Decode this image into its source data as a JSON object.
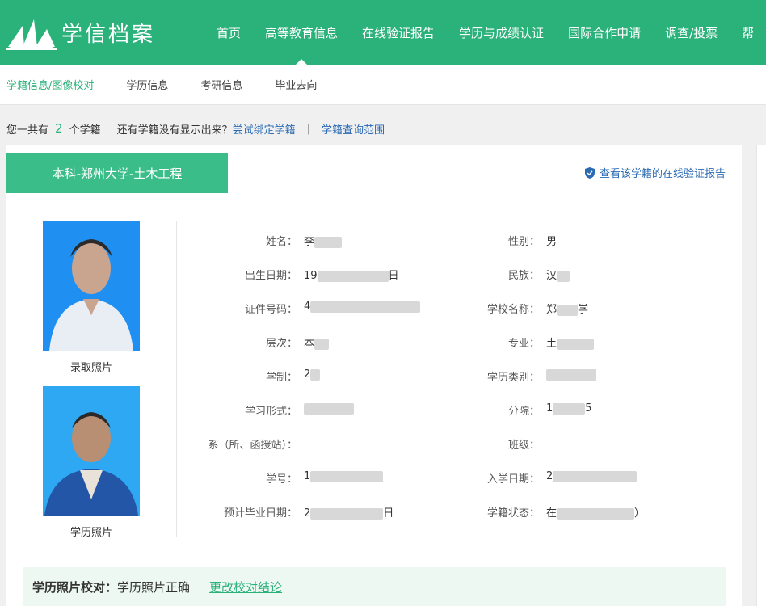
{
  "brand": {
    "name": "学信档案",
    "color": "#2bb17a"
  },
  "nav": [
    "首页",
    "高等教育信息",
    "在线验证报告",
    "学历与成绩认证",
    "国际合作申请",
    "调查/投票",
    "帮"
  ],
  "nav_active_index": 1,
  "subnav": [
    "学籍信息/图像校对",
    "学历信息",
    "考研信息",
    "毕业去向"
  ],
  "info": {
    "prefix": "您一共有",
    "count": "2",
    "suffix": "个学籍",
    "question": "还有学籍没有显示出来？",
    "bind_link": "尝试绑定学籍",
    "separator": "|",
    "scope_link": "学籍查询范围"
  },
  "record": {
    "title": "本科-郑州大学-土木工程",
    "verify_link": "查看该学籍的在线验证报告",
    "photo1_label": "录取照片",
    "photo2_label": "学历照片",
    "left_fields": [
      {
        "label": "姓名：",
        "value": "李"
      },
      {
        "label": "出生日期：",
        "value": "19"
      },
      {
        "label": "证件号码：",
        "value": "4"
      },
      {
        "label": "层次：",
        "value": "本"
      },
      {
        "label": "学制：",
        "value": "2"
      },
      {
        "label": "学习形式：",
        "value": ""
      },
      {
        "label": "系（所、函授站）：",
        "value": ""
      },
      {
        "label": "学号：",
        "value": "1"
      },
      {
        "label": "预计毕业日期：",
        "value": "2"
      }
    ],
    "right_fields": [
      {
        "label": "性别：",
        "value": "男"
      },
      {
        "label": "民族：",
        "value": "汉"
      },
      {
        "label": "学校名称：",
        "value": "郑"
      },
      {
        "label": "专业：",
        "value": "土"
      },
      {
        "label": "学历类别：",
        "value": ""
      },
      {
        "label": "分院：",
        "value": "1"
      },
      {
        "label": "班级：",
        "value": ""
      },
      {
        "label": "入学日期：",
        "value": "2"
      },
      {
        "label": "学籍状态：",
        "value": "在"
      }
    ],
    "tail_texts": {
      "birth": "日",
      "school": "学",
      "branch": "5",
      "grad": "日",
      "status": "）"
    }
  },
  "photo_check": {
    "label": "学历照片校对：",
    "value": "学历照片正确",
    "link": "更改校对结论"
  }
}
